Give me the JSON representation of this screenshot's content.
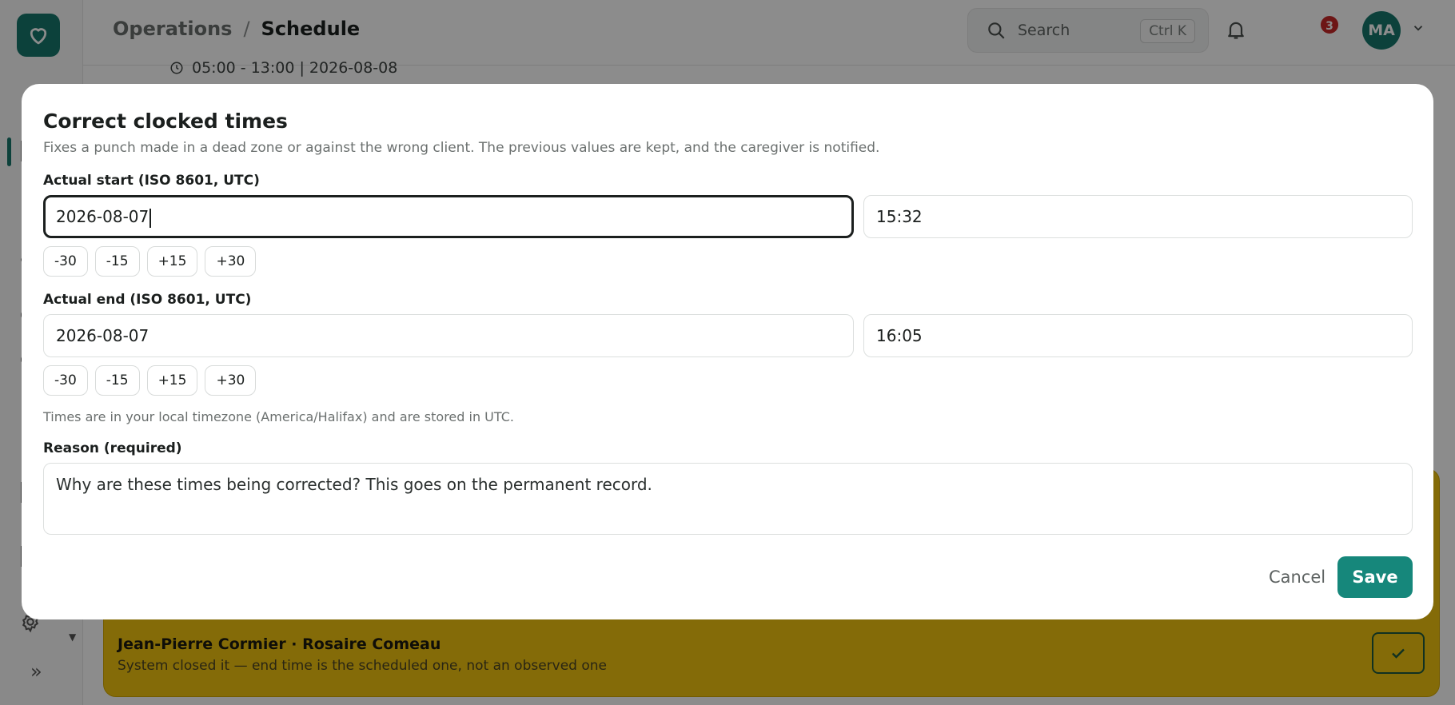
{
  "header": {
    "breadcrumb_parent": "Operations",
    "breadcrumb_separator": "/",
    "breadcrumb_current": "Schedule",
    "search_label": "Search",
    "search_shortcut": "Ctrl K",
    "notification_count": "3",
    "avatar_initials": "MA"
  },
  "background": {
    "shift_meta": "05:00 - 13:00 | 2026-08-08",
    "alert_title": "Jean-Pierre Cormier · Rosaire Comeau",
    "alert_subtitle": "System closed it — end time is the scheduled one, not an observed one"
  },
  "modal": {
    "title": "Correct clocked times",
    "description": "Fixes a punch made in a dead zone or against the wrong client. The previous values are kept, and the caregiver is notified.",
    "start_label": "Actual start (ISO 8601, UTC)",
    "start_date": "2026-08-07",
    "start_time": "15:32",
    "end_label": "Actual end (ISO 8601, UTC)",
    "end_date": "2026-08-07",
    "end_time": "16:05",
    "adjust_buttons": [
      "-30",
      "-15",
      "+15",
      "+30"
    ],
    "timezone_hint": "Times are in your local timezone (America/Halifax) and are stored in UTC.",
    "reason_label": "Reason (required)",
    "reason_placeholder": "Why are these times being corrected? This goes on the permanent record.",
    "cancel_label": "Cancel",
    "save_label": "Save"
  },
  "colors": {
    "brand": "#16776c",
    "save_button": "#16877b",
    "alert_card": "#f1c40f",
    "badge": "#c62828"
  }
}
